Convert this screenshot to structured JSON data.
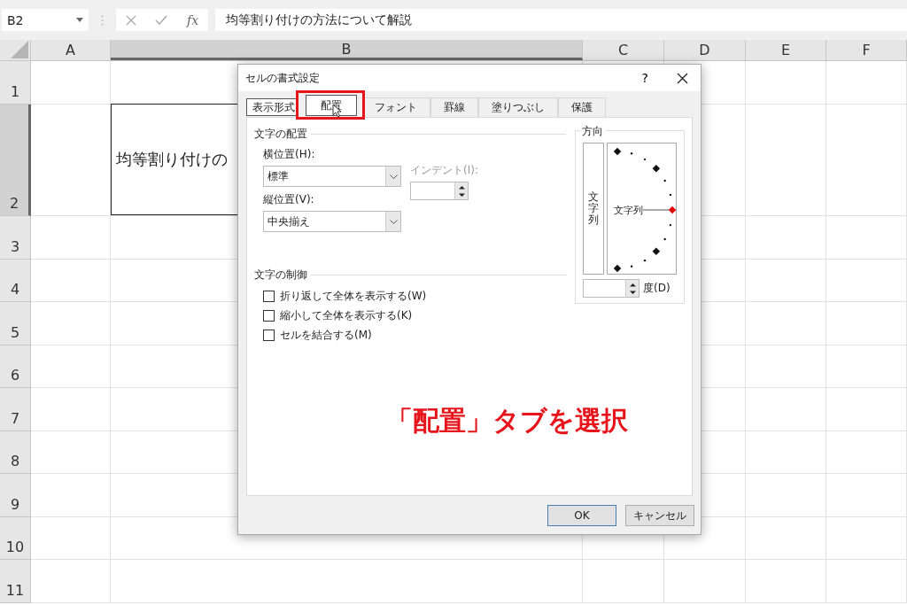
{
  "formula_bar": {
    "name_box": "B2",
    "function_label": "fx",
    "formula": "均等割り付けの方法について解説"
  },
  "sheet": {
    "columns": [
      {
        "label": "A",
        "selected": false
      },
      {
        "label": "B",
        "selected": true
      },
      {
        "label": "C",
        "selected": false
      },
      {
        "label": "D",
        "selected": false
      },
      {
        "label": "E",
        "selected": false
      },
      {
        "label": "F",
        "selected": false
      }
    ],
    "rows": [
      {
        "label": "1",
        "selected": false
      },
      {
        "label": "2",
        "selected": true
      },
      {
        "label": "3",
        "selected": false
      },
      {
        "label": "4",
        "selected": false
      },
      {
        "label": "5",
        "selected": false
      },
      {
        "label": "6",
        "selected": false
      },
      {
        "label": "7",
        "selected": false
      },
      {
        "label": "8",
        "selected": false
      },
      {
        "label": "9",
        "selected": false
      },
      {
        "label": "10",
        "selected": false
      },
      {
        "label": "11",
        "selected": false
      }
    ],
    "active_cell_text": "均等割り付けの"
  },
  "dialog": {
    "title": "セルの書式設定",
    "help": "?",
    "tabs": [
      {
        "label": "表示形式",
        "selected": false,
        "annotated": false
      },
      {
        "label": "配置",
        "selected": true,
        "annotated": true
      },
      {
        "label": "フォント",
        "selected": false,
        "annotated": false
      },
      {
        "label": "罫線",
        "selected": false,
        "annotated": false
      },
      {
        "label": "塗りつぶし",
        "selected": false,
        "annotated": false
      },
      {
        "label": "保護",
        "selected": false,
        "annotated": false
      }
    ],
    "text_alignment": {
      "heading": "文字の配置",
      "horizontal_label": "横位置(H):",
      "horizontal_value": "標準",
      "vertical_label": "縦位置(V):",
      "vertical_value": "中央揃え",
      "indent_label": "インデント(I):",
      "indent_disabled": true
    },
    "text_control": {
      "heading": "文字の制御",
      "options": [
        {
          "label": "折り返して全体を表示する(W)",
          "checked": false
        },
        {
          "label": "縮小して全体を表示する(K)",
          "checked": false
        },
        {
          "label": "セルを結合する(M)",
          "checked": false
        }
      ]
    },
    "orientation": {
      "heading": "方向",
      "vertical_text": "文字列",
      "dial_text": "文字列",
      "degrees_label": "度(D)"
    },
    "buttons": [
      {
        "label": "OK",
        "default": true
      },
      {
        "label": "キャンセル",
        "default": false
      }
    ]
  },
  "annotation": {
    "text": "「配置」タブを選択"
  }
}
